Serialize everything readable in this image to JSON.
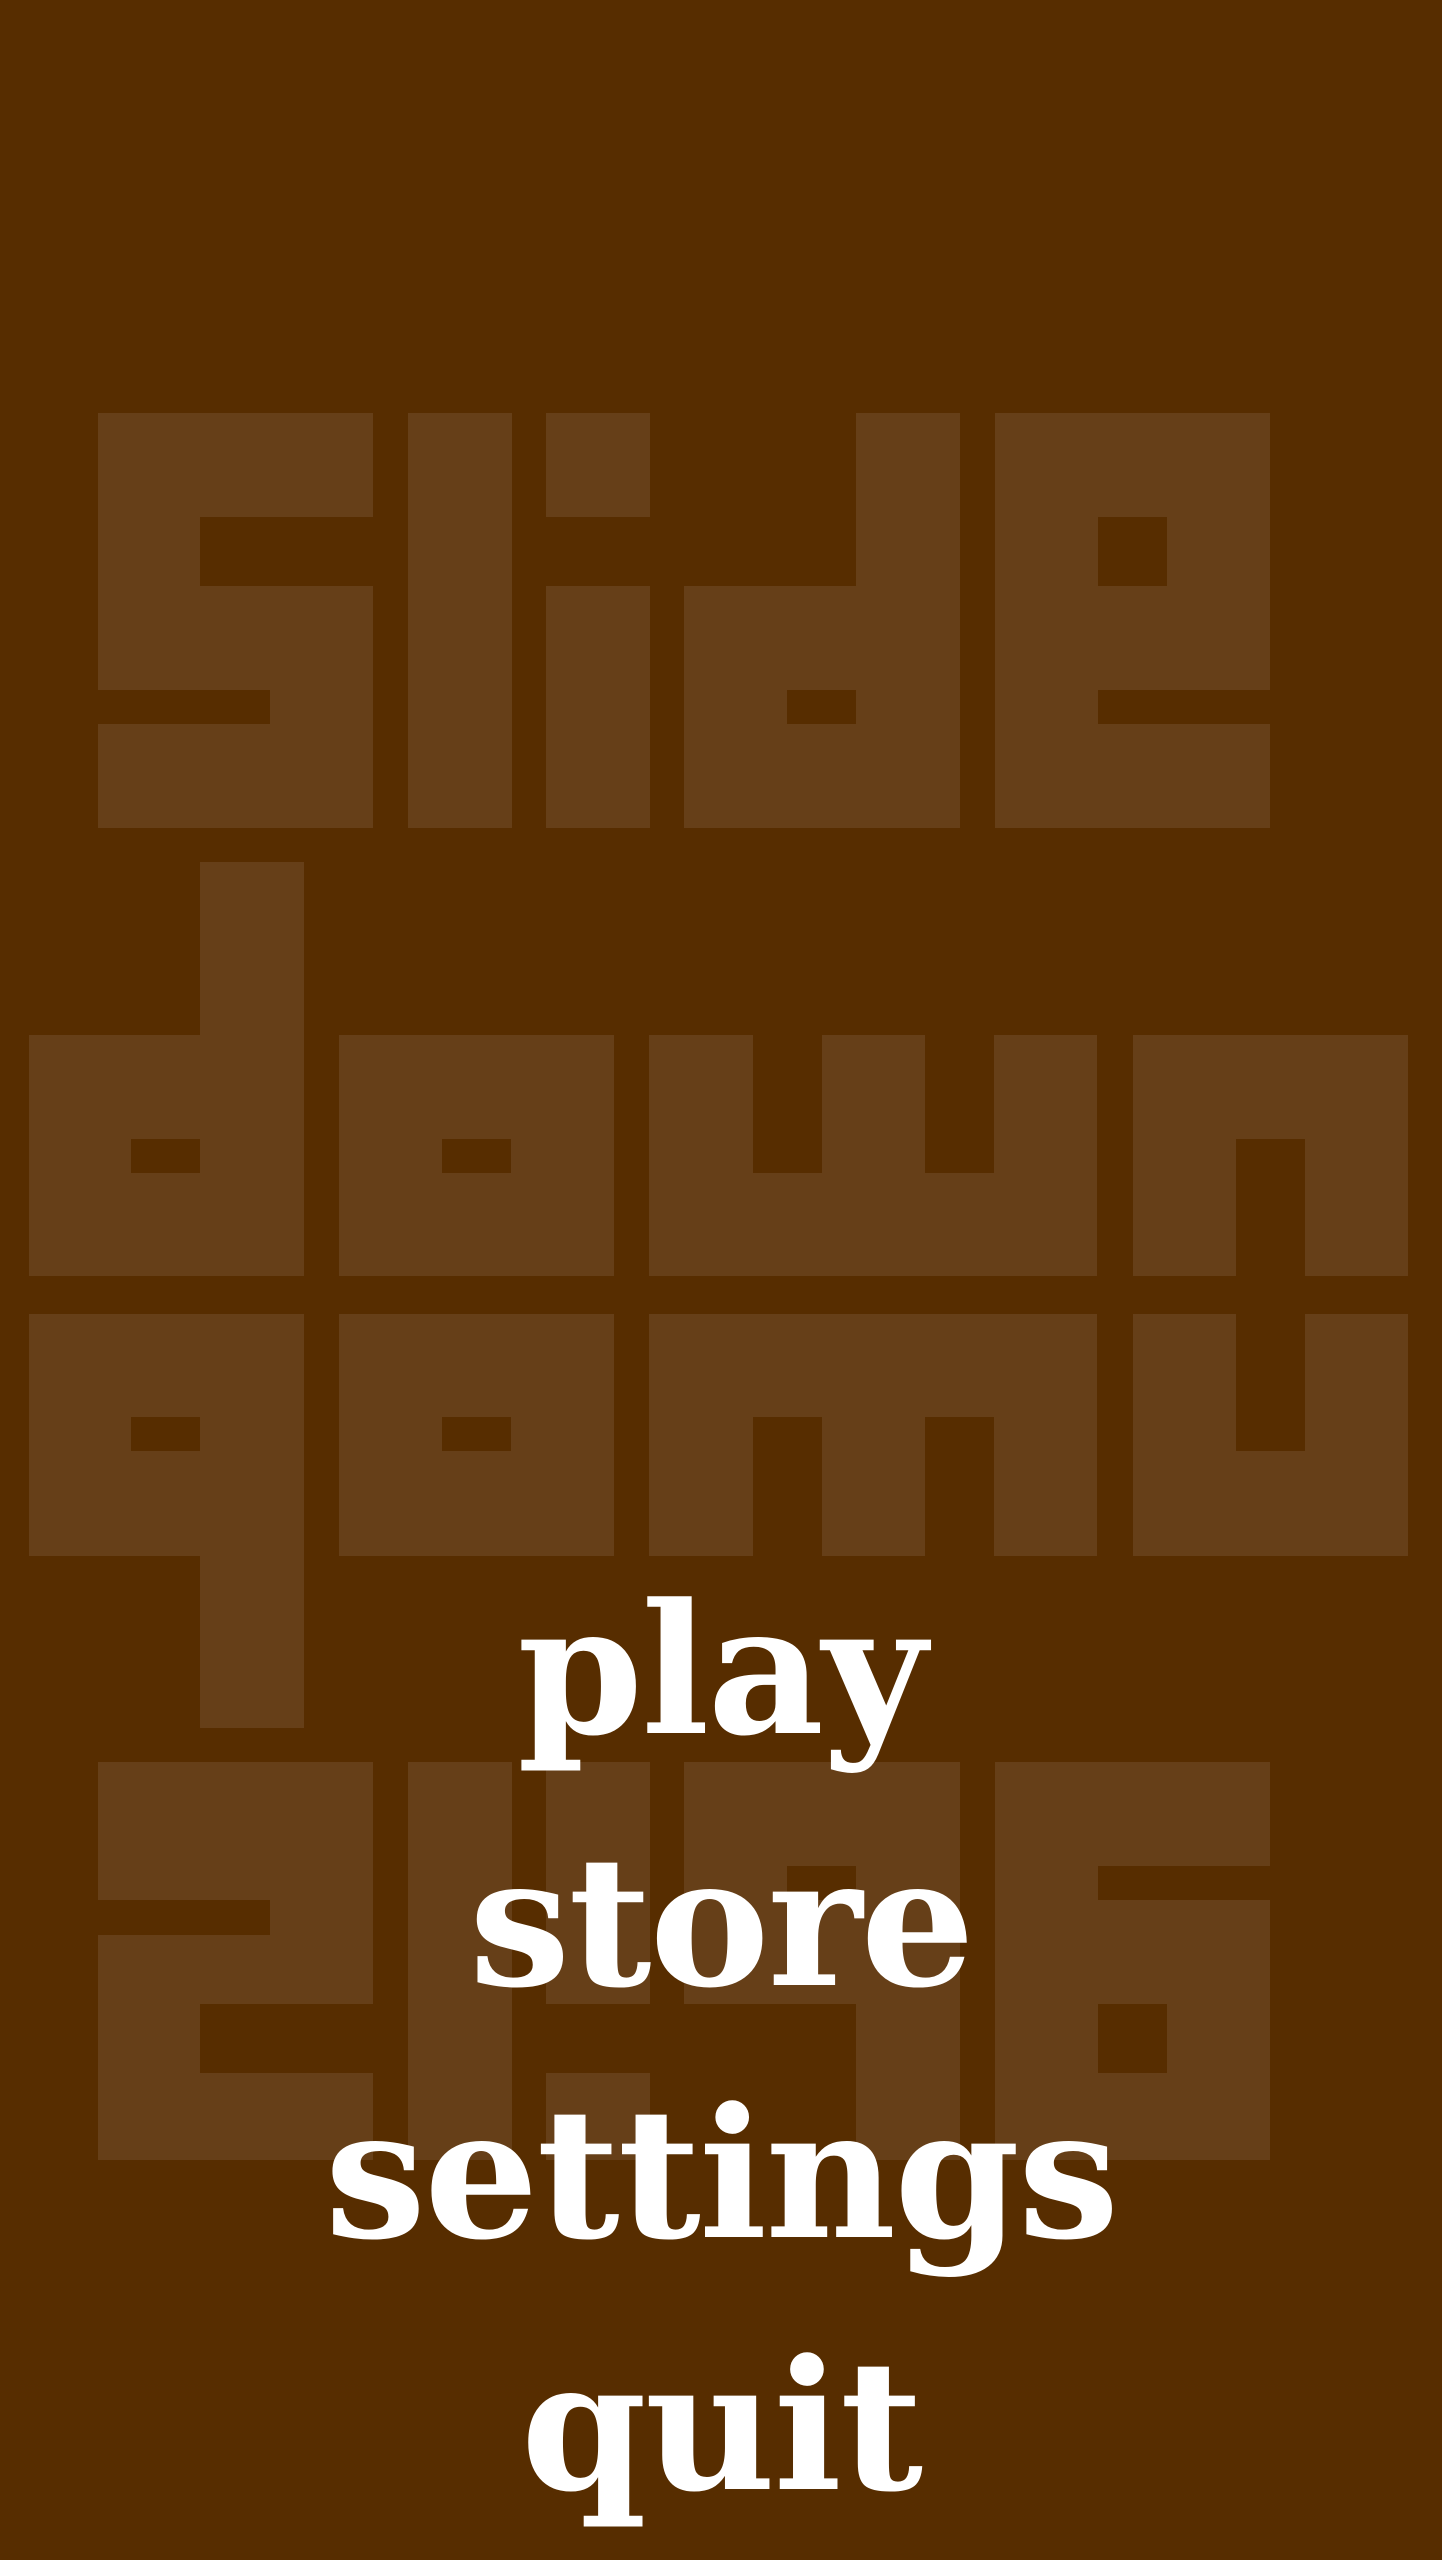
{
  "logo": {
    "words": [
      "slide",
      "down"
    ],
    "colors": {
      "background": "#572d00",
      "block": "#7f5e3e"
    }
  },
  "menu": {
    "items": [
      {
        "id": "play",
        "label": "play"
      },
      {
        "id": "store",
        "label": "store"
      },
      {
        "id": "settings",
        "label": "settings"
      },
      {
        "id": "quit",
        "label": "quit"
      }
    ]
  }
}
